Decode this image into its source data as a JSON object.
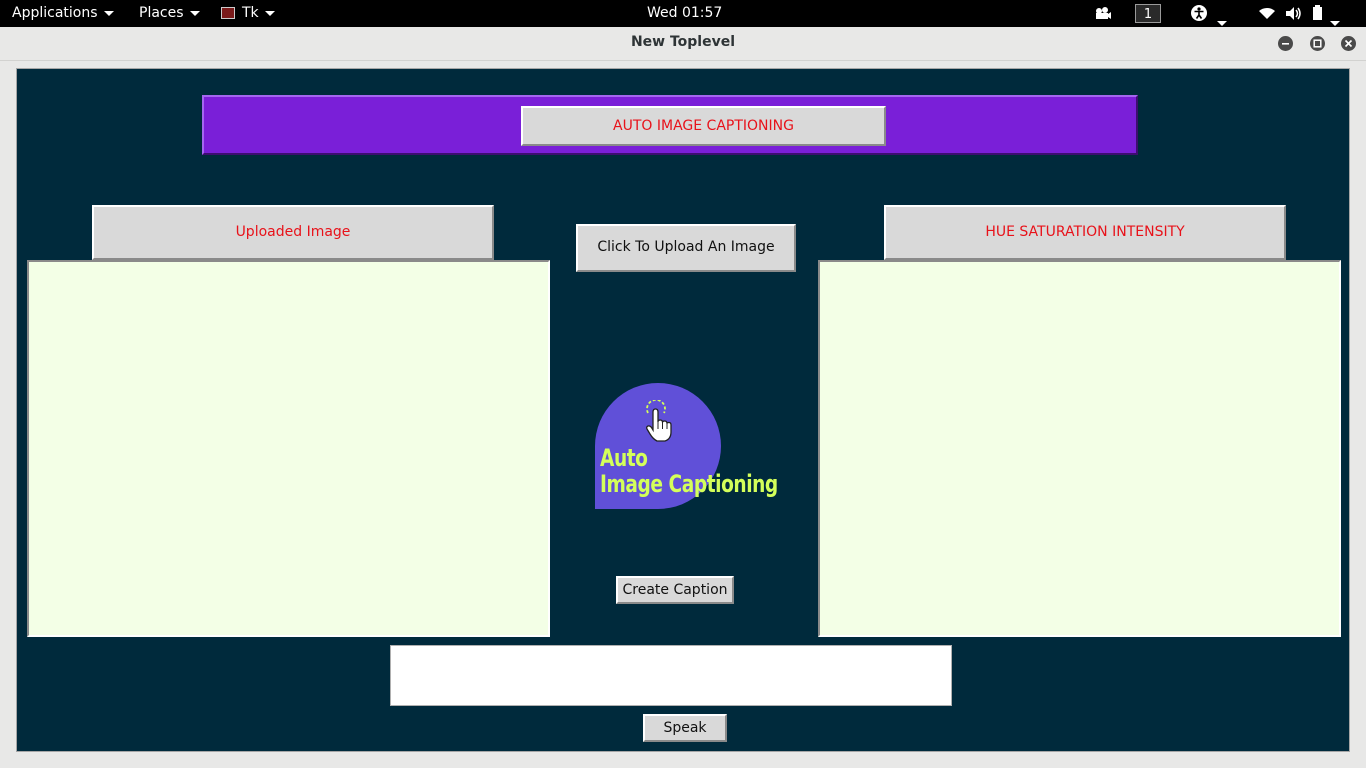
{
  "topbar": {
    "applications": "Applications",
    "places": "Places",
    "app_menu": "Tk",
    "clock": "Wed 01:57",
    "workspace": "1"
  },
  "window": {
    "title": "New Toplevel"
  },
  "app": {
    "banner_label": "AUTO IMAGE CAPTIONING",
    "uploaded_image_label": "Uploaded Image",
    "upload_button": "Click To Upload An Image",
    "hsi_label": "HUE SATURATION INTENSITY",
    "create_caption_button": "Create Caption",
    "caption_text": "",
    "speak_button": "Speak",
    "logo": {
      "line1": "Auto",
      "line2": "Image Captioning"
    }
  },
  "colors": {
    "background": "#002a3c",
    "banner": "#7a1fd8",
    "panel": "#f3ffe6",
    "label_text": "#e8121a",
    "logo_circle": "#6050d8",
    "logo_text": "#d4ff5a"
  },
  "icons": [
    "camera-icon",
    "accessibility-icon",
    "wifi-icon",
    "volume-icon",
    "battery-icon",
    "minimize-icon",
    "maximize-icon",
    "close-icon",
    "pointer-hand-icon"
  ]
}
